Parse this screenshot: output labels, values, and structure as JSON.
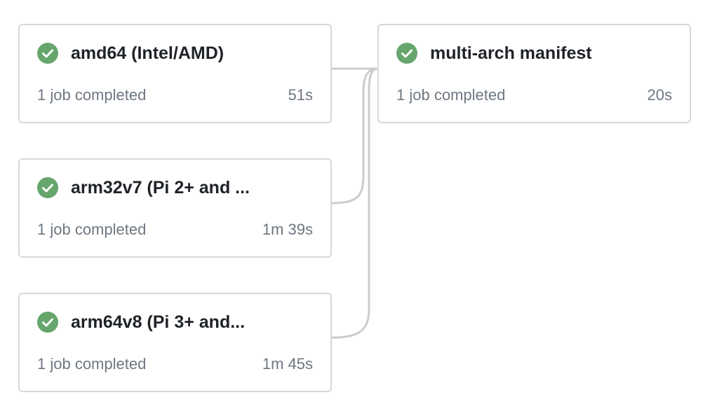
{
  "colors": {
    "success": "#66a66d",
    "connector": "#cccccc",
    "card_border": "#d8d8d8"
  },
  "jobs": [
    {
      "name": "amd64 (Intel/AMD)",
      "status_icon": "check-circle-icon",
      "summary": "1 job completed",
      "duration": "51s"
    },
    {
      "name": "arm32v7 (Pi 2+ and ...",
      "status_icon": "check-circle-icon",
      "summary": "1 job completed",
      "duration": "1m 39s"
    },
    {
      "name": "arm64v8 (Pi 3+ and...",
      "status_icon": "check-circle-icon",
      "summary": "1 job completed",
      "duration": "1m 45s"
    },
    {
      "name": "multi-arch manifest",
      "status_icon": "check-circle-icon",
      "summary": "1 job completed",
      "duration": "20s"
    }
  ]
}
